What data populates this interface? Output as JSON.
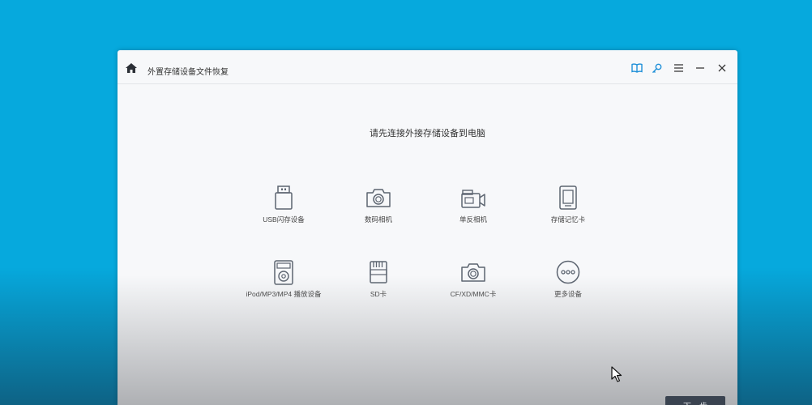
{
  "window": {
    "title": "外置存储设备文件恢复",
    "heading": "请先连接外接存储设备到电脑"
  },
  "toolbar": {
    "icons": [
      "book-icon",
      "key-icon",
      "menu-icon",
      "minimize-icon",
      "close-icon"
    ],
    "accent_color": "#1e8fd8"
  },
  "devices": [
    {
      "label": "USB闪存设备",
      "icon": "usb-drive-icon"
    },
    {
      "label": "数码相机",
      "icon": "camera-icon"
    },
    {
      "label": "单反相机",
      "icon": "video-camera-icon"
    },
    {
      "label": "存储记忆卡",
      "icon": "memory-card-icon"
    },
    {
      "label": "iPod/MP3/MP4 播放设备",
      "icon": "media-player-icon"
    },
    {
      "label": "SD卡",
      "icon": "sd-card-icon"
    },
    {
      "label": "CF/XD/MMC卡",
      "icon": "camera-icon"
    },
    {
      "label": "更多设备",
      "icon": "more-icon"
    }
  ],
  "footer": {
    "next_label": "下一步"
  },
  "colors": {
    "desktop": "#06a9dd",
    "window_bg": "#f7f8fa",
    "icon_stroke": "#5c6470"
  }
}
